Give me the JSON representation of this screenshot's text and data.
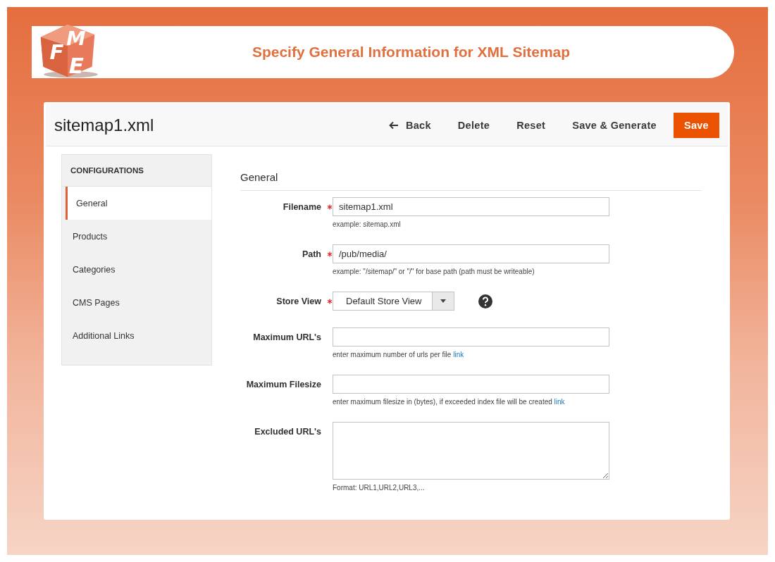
{
  "logo": {
    "letters": [
      "F",
      "M",
      "E"
    ]
  },
  "banner": {
    "title": "Specify General Information for XML Sitemap"
  },
  "page": {
    "title": "sitemap1.xml"
  },
  "actions": [
    {
      "label": "Back",
      "kind": "back"
    },
    {
      "label": "Delete",
      "kind": "plain"
    },
    {
      "label": "Reset",
      "kind": "plain"
    },
    {
      "label": "Save & Generate",
      "kind": "plain"
    },
    {
      "label": "Save",
      "kind": "primary"
    }
  ],
  "sidebar": {
    "heading": "CONFIGURATIONS",
    "items": [
      {
        "label": "General",
        "selected": true
      },
      {
        "label": "Products",
        "selected": false
      },
      {
        "label": "Categories",
        "selected": false
      },
      {
        "label": "CMS Pages",
        "selected": false
      },
      {
        "label": "Additional Links",
        "selected": false
      }
    ]
  },
  "section": {
    "title": "General"
  },
  "fields": [
    {
      "label": "Filename",
      "kind": "text",
      "required": true,
      "value": "sitemap1.xml",
      "note": "example: sitemap.xml"
    },
    {
      "label": "Path",
      "kind": "text",
      "required": true,
      "value": "/pub/media/",
      "note": "example: \"/sitemap/\" or \"/\" for base path (path must be writeable)"
    },
    {
      "label": "Store View",
      "kind": "select",
      "required": true,
      "value": "Default Store View",
      "help": true
    },
    {
      "label": "Maximum URL's",
      "kind": "text",
      "required": false,
      "note": "enter maximum number of urls per file",
      "link": "link"
    },
    {
      "label": "Maximum Filesize",
      "kind": "text",
      "required": false,
      "note": "enter maximum filesize in (bytes), if exceeded index file will be created",
      "link": "link"
    },
    {
      "label": "Excluded URL's",
      "kind": "textarea",
      "required": false,
      "note": "Format: URL1,URL2,URL3,..."
    }
  ]
}
